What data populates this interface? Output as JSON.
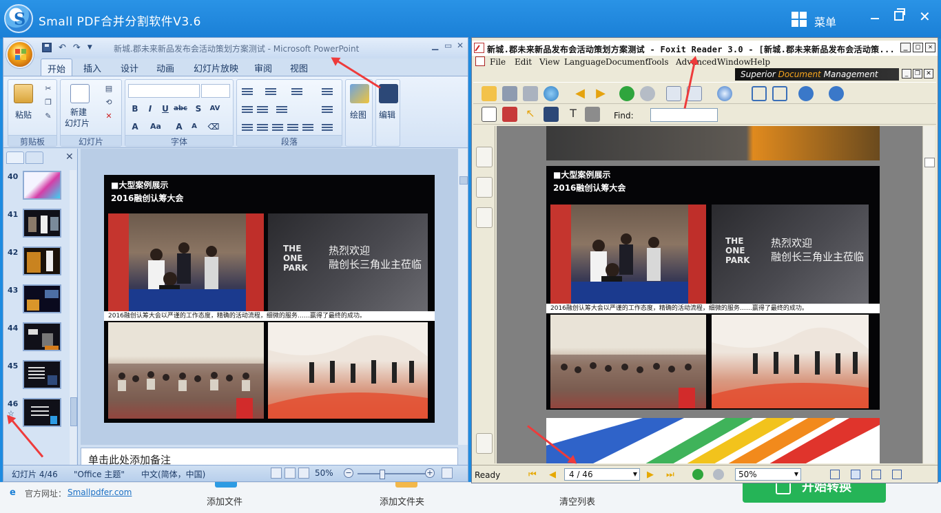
{
  "host": {
    "title": "Small PDF合并分割软件V3.6",
    "menu_label": "菜单",
    "site_label": "官方网址：",
    "site_link": "Smallpdfer.com",
    "add_file": "添加文件",
    "add_folder": "添加文件夹",
    "clear_list": "清空列表",
    "start": "开始转换"
  },
  "powerpoint": {
    "title": "新城.郡未来新品发布会活动策划方案测试 - Microsoft PowerPoint",
    "tabs": [
      "开始",
      "插入",
      "设计",
      "动画",
      "幻灯片放映",
      "审阅",
      "视图"
    ],
    "ribbon": {
      "paste": "粘贴",
      "clipboard": "剪贴板",
      "new_slide": "新建\n幻灯片",
      "new_slide_line1": "新建",
      "new_slide_line2": "幻灯片",
      "slides_group": "幻灯片",
      "font_group": "字体",
      "paragraph_group": "段落",
      "drawing": "绘图",
      "editing": "编辑"
    },
    "thumbnails": [
      "40",
      "41",
      "42",
      "43",
      "44",
      "45",
      "46"
    ],
    "slide": {
      "title_line1": "■大型案例展示",
      "title_line2": "2016融创认筹大会",
      "caption": "2016融创认筹大会以严谨的工作态度，精确的活动流程，细微的服务……赢得了最终的成功。",
      "banner_line1": "热烈欢迎",
      "banner_line2": "融创长三角业主莅临",
      "banner_brand_1": "THE",
      "banner_brand_2": "ONE",
      "banner_brand_3": "PARK"
    },
    "notes_placeholder": "单击此处添加备注",
    "status": {
      "slide_info": "幻灯片 4/46",
      "theme": "\"Office 主题\"",
      "language": "中文(简体，中国)",
      "zoom": "50%"
    }
  },
  "foxit": {
    "title": "新城.郡未来新品发布会活动策划方案测试 - Foxit Reader 3.0 - [新城.郡未来新品发布会活动策...",
    "menu": [
      "File",
      "Edit",
      "View",
      "Language",
      "Document",
      "Tools",
      "Advanced",
      "Window",
      "Help"
    ],
    "brand_prefix": "Superior ",
    "brand_highlight": "Document",
    "brand_suffix": " Management",
    "find_label": "Find:",
    "page": {
      "title_line1": "■大型案例展示",
      "title_line2": "2016融创认筹大会",
      "caption": "2016融创认筹大会以严谨的工作态度，精确的活动流程，细微的服务……赢得了最终的成功。"
    },
    "status": {
      "ready": "Ready",
      "page_value": "4 / 46",
      "zoom_value": "50%"
    }
  },
  "colors": {
    "host_blue": "#1a7fd6",
    "start_green": "#25b457",
    "arrow_red": "#ee3b3b",
    "office_orange": "#f3a41b"
  }
}
